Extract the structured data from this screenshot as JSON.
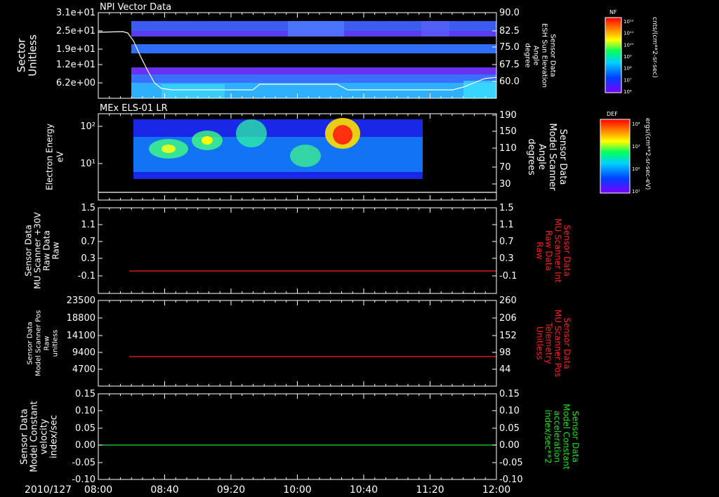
{
  "colors": {
    "white": "#ffffff",
    "red": "#ff2020",
    "green": "#20e020"
  },
  "panels": [
    {
      "title": "NPI Vector Data",
      "left_label": [
        "Sector",
        "Unitless"
      ],
      "left_ticks": [
        "3.1e+01",
        "2.5e+01",
        "1.9e+01",
        "1.2e+01",
        "6.2e+00"
      ],
      "right_ticks": [
        "90.0",
        "82.5",
        "75.0",
        "67.5",
        "60.0"
      ],
      "right_label": [
        "Sensor Data",
        "ESH Sun Elevation",
        "Angle",
        "degree"
      ],
      "right_label_color": "#ffffff",
      "colorbar": {
        "title": "NF",
        "ticks": [
          "10¹²",
          "10¹¹",
          "10¹⁰",
          "10⁹",
          "10⁸",
          "10⁷",
          "10⁶"
        ],
        "unit": "cnts/(cm**2-sr-sec)"
      }
    },
    {
      "title": "MEx ELS-01 LR",
      "left_label": [
        "Electron Energy",
        "eV"
      ],
      "left_ticks": [
        "10²",
        "10¹"
      ],
      "right_ticks": [
        "190",
        "150",
        "110",
        "70",
        "30"
      ],
      "right_label": [
        "Sensor Data",
        "Model Scanner",
        "Angle",
        "degrees"
      ],
      "right_label_color": "#ffffff",
      "colorbar": {
        "title": "DEF",
        "ticks": [
          "10⁴",
          "10³",
          "10²",
          "10¹"
        ],
        "unit": "ergs/(cm**2-sr-sec-eV)"
      }
    },
    {
      "title": "",
      "left_label": [
        "Sensor Data",
        "MU Scanner +30V",
        "Raw Data",
        "Raw"
      ],
      "left_ticks": [
        "1.5",
        "1.1",
        "0.7",
        "0.3",
        "-0.1"
      ],
      "right_ticks": [
        "1.5",
        "1.1",
        "0.7",
        "0.3",
        "-0.1"
      ],
      "right_label": [
        "Sensor Data",
        "MU Scanner Int",
        "Raw Data",
        "Raw"
      ],
      "right_label_color": "#ff2020"
    },
    {
      "title": "",
      "left_label": [
        "Sensor Data",
        "Model Scanner Pos",
        "Raw",
        "unitless"
      ],
      "left_ticks": [
        "23500",
        "18800",
        "14100",
        "9400",
        "4700"
      ],
      "right_ticks": [
        "260",
        "206",
        "152",
        "98",
        "44"
      ],
      "right_label": [
        "Sensor Data",
        "MU Scanner Pos",
        "Telemetry",
        "Unitless"
      ],
      "right_label_color": "#ff2020"
    },
    {
      "title": "",
      "left_label": [
        "Sensor Data",
        "Model Constant",
        "velocity",
        "index/sec"
      ],
      "left_ticks": [
        "0.15",
        "0.10",
        "0.05",
        "0.00",
        "-0.05",
        "-0.10"
      ],
      "right_ticks": [
        "0.15",
        "0.10",
        "0.05",
        "0.00",
        "-0.05",
        "-0.10"
      ],
      "right_label": [
        "Sensor Data",
        "Model Constant",
        "acceleration",
        "index/sec**2"
      ],
      "right_label_color": "#20e020"
    }
  ],
  "x_axis": {
    "date": "2010/127",
    "ticks": [
      "08:00",
      "08:40",
      "09:20",
      "10:00",
      "10:40",
      "11:20",
      "12:00"
    ]
  }
}
